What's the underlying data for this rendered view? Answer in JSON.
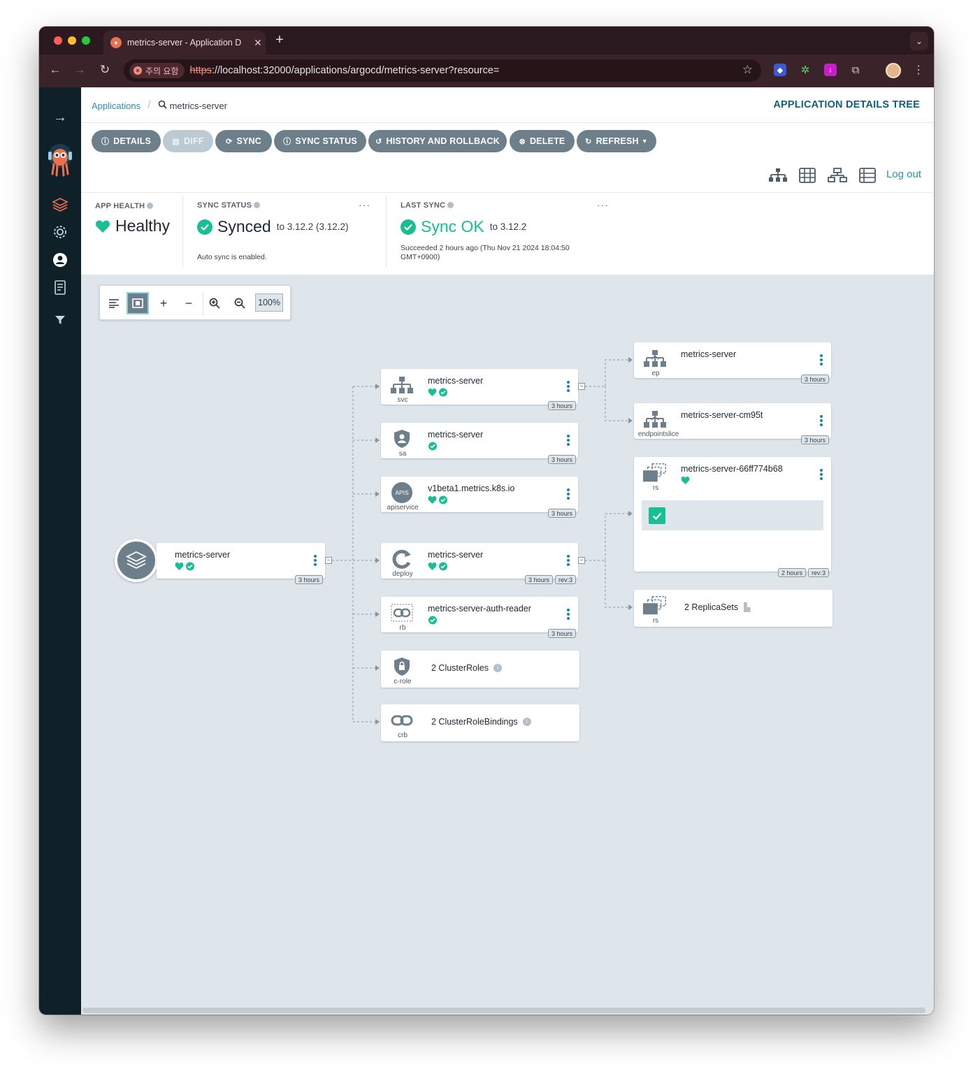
{
  "browser": {
    "tab_title": "metrics-server - Application D",
    "security_warning": "주의 요함",
    "url_scheme": "https",
    "url_rest": "://localhost:32000/applications/argocd/metrics-server?resource="
  },
  "breadcrumb": {
    "applications": "Applications",
    "current": "metrics-server"
  },
  "page_title": "APPLICATION DETAILS TREE",
  "actions": {
    "details": "DETAILS",
    "diff": "DIFF",
    "sync": "SYNC",
    "sync_status": "SYNC STATUS",
    "history": "HISTORY AND ROLLBACK",
    "delete": "DELETE",
    "refresh": "REFRESH"
  },
  "logout": "Log out",
  "status": {
    "app_health_label": "APP HEALTH",
    "app_health_value": "Healthy",
    "sync_status_label": "SYNC STATUS",
    "sync_status_value": "Synced",
    "sync_status_to": "to 3.12.2 (3.12.2)",
    "auto_sync": "Auto sync is enabled.",
    "last_sync_label": "LAST SYNC",
    "last_sync_value": "Sync OK",
    "last_sync_to": "to 3.12.2",
    "last_sync_detail_1": "Succeeded 2 hours ago (Thu Nov 21 2024 18:04:50",
    "last_sync_detail_2": "GMT+0900)"
  },
  "zoom": {
    "level": "100%"
  },
  "colors": {
    "healthy": "#18be94",
    "accent": "#0e6178",
    "button": "#6d7f8b"
  },
  "graph": {
    "root": {
      "name": "metrics-server",
      "age": "3 hours"
    },
    "svc": {
      "name": "metrics-server",
      "kind": "svc",
      "age": "3 hours"
    },
    "sa": {
      "name": "metrics-server",
      "kind": "sa",
      "age": "3 hours"
    },
    "apiservice": {
      "name": "v1beta1.metrics.k8s.io",
      "kind": "apiservice",
      "age": "3 hours",
      "icon_text": "APIS"
    },
    "deploy": {
      "name": "metrics-server",
      "kind": "deploy",
      "age": "3 hours",
      "rev": "rev:3"
    },
    "rb": {
      "name": "metrics-server-auth-reader",
      "kind": "rb",
      "age": "3 hours"
    },
    "crole": {
      "label": "2 ClusterRoles",
      "kind": "c-role"
    },
    "crb": {
      "label": "2 ClusterRoleBindings",
      "kind": "crb"
    },
    "ep": {
      "name": "metrics-server",
      "kind": "ep",
      "age": "3 hours"
    },
    "endpointslice": {
      "name": "metrics-server-cm95t",
      "kind": "endpointslice",
      "age": "3 hours"
    },
    "rs": {
      "name": "metrics-server-66ff774b68",
      "kind": "rs",
      "age": "2 hours",
      "rev": "rev:3"
    },
    "rs_group": {
      "label": "2 ReplicaSets",
      "kind": "rs"
    }
  }
}
